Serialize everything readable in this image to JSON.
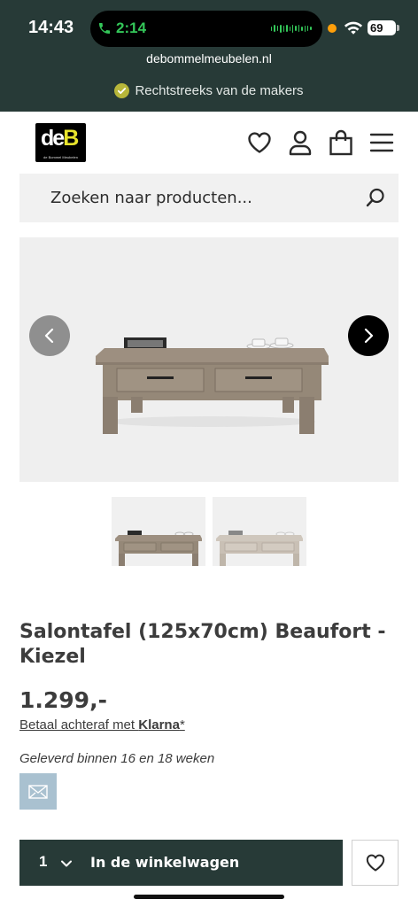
{
  "status_bar": {
    "time": "14:43",
    "call_timer": "2:14",
    "battery": "69"
  },
  "browser": {
    "url": "debommelmeubelen.nl"
  },
  "usp_bar": {
    "text": "Rechtstreeks van de makers"
  },
  "header": {
    "logo_letters_a": "de",
    "logo_letters_b": "B",
    "logo_tagline": "de Bommel Meubelen",
    "icons": [
      "heart-icon",
      "user-icon",
      "shopping-bag-icon",
      "menu-icon"
    ]
  },
  "search": {
    "placeholder": "Zoeken naar producten..."
  },
  "product": {
    "title": "Salontafel (125x70cm) Beaufort - Kiezel",
    "price": "1.299,-",
    "klarna_prefix": "Betaal achteraf met ",
    "klarna_brand": "Klarna",
    "klarna_suffix": "*",
    "delivery": "Geleverd binnen 16 en 18 weken"
  },
  "cart": {
    "quantity": "1",
    "button_label": "In de winkelwagen"
  },
  "colors": {
    "brand_dark": "#273a37",
    "logo_yellow": "#e8e42c",
    "usp_check": "#b7b63a",
    "swatch": "#a9c1d0"
  }
}
